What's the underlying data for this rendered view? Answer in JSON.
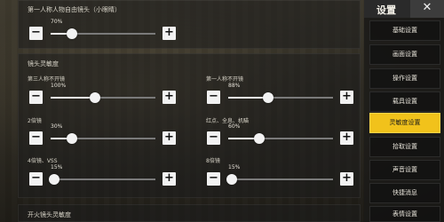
{
  "close_glyph": "✕",
  "top_section": {
    "title": "第一人称人物自由镜头（小眼睛）",
    "slider": {
      "value_label": "70%",
      "value": 0.7
    }
  },
  "sensitivity_section": {
    "title": "镜头灵敏度",
    "rows": [
      {
        "label": "第三人称不开镜",
        "value_label": "100%",
        "value": 0.42
      },
      {
        "label": "第一人称不开镜",
        "value_label": "88%",
        "value": 0.38
      },
      {
        "label": "2倍镜",
        "value_label": "30%",
        "value": 0.2
      },
      {
        "label": "红点、全息、机瞄",
        "value_label": "60%",
        "value": 0.3
      },
      {
        "label": "4倍镜、VSS",
        "value_label": "15%",
        "value": 0.15
      },
      {
        "label": "8倍镜",
        "value_label": "15%",
        "value": 0.15
      }
    ]
  },
  "bottom_section": {
    "title": "开火镜头灵敏度"
  },
  "buttons": {
    "minus": "−",
    "plus": "+"
  },
  "sidebar": {
    "title": "设置",
    "items": [
      {
        "label": "基础设置",
        "active": false
      },
      {
        "label": "画面设置",
        "active": false
      },
      {
        "label": "操作设置",
        "active": false
      },
      {
        "label": "载具设置",
        "active": false
      },
      {
        "label": "灵敏度设置",
        "active": true
      },
      {
        "label": "拾取设置",
        "active": false
      },
      {
        "label": "声音设置",
        "active": false
      },
      {
        "label": "快捷消息",
        "active": false
      },
      {
        "label": "表情设置",
        "active": false
      }
    ]
  },
  "colors": {
    "accent": "#f1c21b"
  }
}
